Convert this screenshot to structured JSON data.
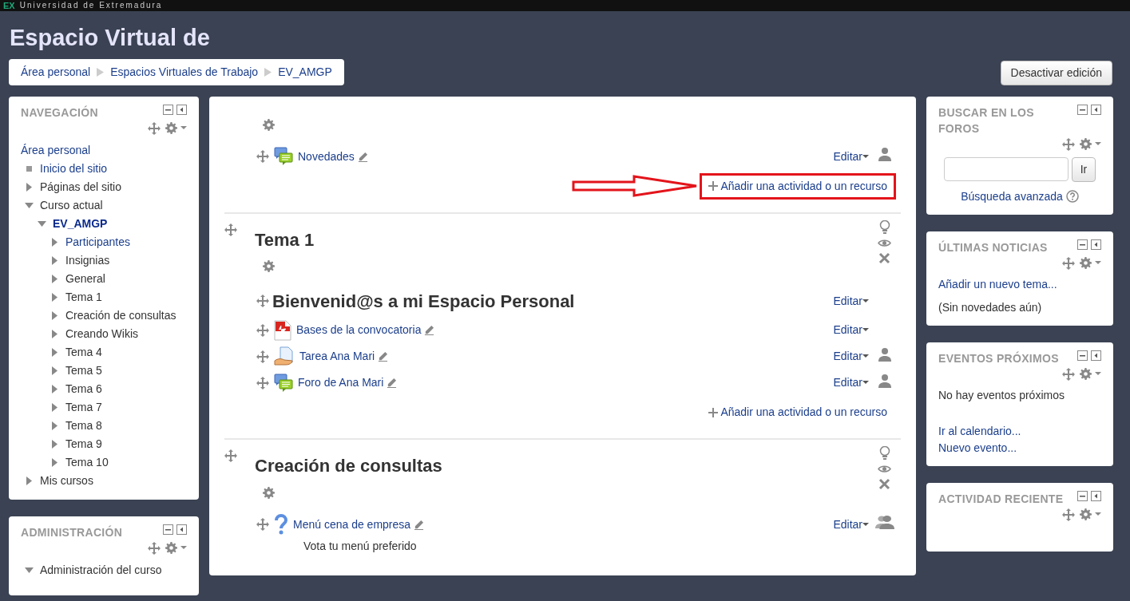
{
  "top_bar": {
    "logo": "EX",
    "text": "Universidad de Extremadura"
  },
  "site_title": "Espacio Virtual de",
  "breadcrumb": [
    "Área personal",
    "Espacios Virtuales de Trabajo",
    "EV_AMGP"
  ],
  "edit_button": "Desactivar edición",
  "left_blocks": [
    {
      "title": "NAVEGACIÓN",
      "items": [
        {
          "label": "Área personal",
          "kind": "root",
          "link": true
        },
        {
          "label": "Inicio del sitio",
          "kind": "leaf",
          "link": true
        },
        {
          "label": "Páginas del sitio",
          "kind": "branch",
          "link": false,
          "expanded": false
        },
        {
          "label": "Curso actual",
          "kind": "branch",
          "link": false,
          "expanded": true,
          "children": [
            {
              "label": "EV_AMGP",
              "kind": "course",
              "link": true,
              "expanded": true,
              "children": [
                {
                  "label": "Participantes",
                  "kind": "branch",
                  "link": true,
                  "expanded": false
                },
                {
                  "label": "Insignias",
                  "kind": "branch",
                  "link": false,
                  "expanded": false
                },
                {
                  "label": "General",
                  "kind": "branch",
                  "link": false,
                  "expanded": false
                },
                {
                  "label": "Tema 1",
                  "kind": "branch",
                  "link": false,
                  "expanded": false
                },
                {
                  "label": "Creación de consultas",
                  "kind": "branch",
                  "link": false,
                  "expanded": false
                },
                {
                  "label": "Creando Wikis",
                  "kind": "branch",
                  "link": false,
                  "expanded": false
                },
                {
                  "label": "Tema 4",
                  "kind": "branch",
                  "link": false,
                  "expanded": false
                },
                {
                  "label": "Tema 5",
                  "kind": "branch",
                  "link": false,
                  "expanded": false
                },
                {
                  "label": "Tema 6",
                  "kind": "branch",
                  "link": false,
                  "expanded": false
                },
                {
                  "label": "Tema 7",
                  "kind": "branch",
                  "link": false,
                  "expanded": false
                },
                {
                  "label": "Tema 8",
                  "kind": "branch",
                  "link": false,
                  "expanded": false
                },
                {
                  "label": "Tema 9",
                  "kind": "branch",
                  "link": false,
                  "expanded": false
                },
                {
                  "label": "Tema 10",
                  "kind": "branch",
                  "link": false,
                  "expanded": false
                }
              ]
            }
          ]
        },
        {
          "label": "Mis cursos",
          "kind": "branch",
          "link": false,
          "expanded": false
        }
      ]
    },
    {
      "title": "ADMINISTRACIÓN",
      "items": [
        {
          "label": "Administración del curso",
          "kind": "branch",
          "link": false,
          "expanded": true
        }
      ]
    }
  ],
  "sections": [
    {
      "activities": [
        {
          "name": "Novedades",
          "kind": "forum",
          "edit": "Editar",
          "group_icon": true,
          "separate_groups": false
        }
      ],
      "add_link": "Añadir una actividad o un recurso",
      "highlighted": true
    },
    {
      "title": "Tema 1",
      "summary": "Bienvenid@s a mi Espacio Personal",
      "summary_edit": "Editar",
      "activities": [
        {
          "name": "Bases de la convocatoria",
          "kind": "pdf",
          "edit": "Editar",
          "group_icon": false
        },
        {
          "name": "Tarea Ana Mari",
          "kind": "assignment",
          "edit": "Editar",
          "group_icon": true,
          "separate_groups": false
        },
        {
          "name": "Foro de Ana Mari",
          "kind": "forum",
          "edit": "Editar",
          "group_icon": true,
          "separate_groups": false
        }
      ],
      "add_link": "Añadir una actividad o un recurso",
      "highlighted": false
    },
    {
      "title": "Creación de consultas",
      "activities": [
        {
          "name": "Menú cena de empresa",
          "kind": "choice",
          "edit": "Editar",
          "group_icon": true,
          "separate_groups": true,
          "description": "Vota tu menú preferido"
        }
      ]
    }
  ],
  "right_blocks": [
    {
      "title": "BUSCAR EN LOS FOROS",
      "kind": "search",
      "button": "Ir",
      "link": "Búsqueda avanzada"
    },
    {
      "title": "ÚLTIMAS NOTICIAS",
      "kind": "news",
      "link": "Añadir un nuevo tema...",
      "text": "(Sin novedades aún)"
    },
    {
      "title": "EVENTOS PRÓXIMOS",
      "kind": "events",
      "text": "No hay eventos próximos",
      "links": [
        "Ir al calendario...",
        "Nuevo evento..."
      ]
    },
    {
      "title": "ACTIVIDAD RECIENTE",
      "kind": "recent"
    }
  ]
}
